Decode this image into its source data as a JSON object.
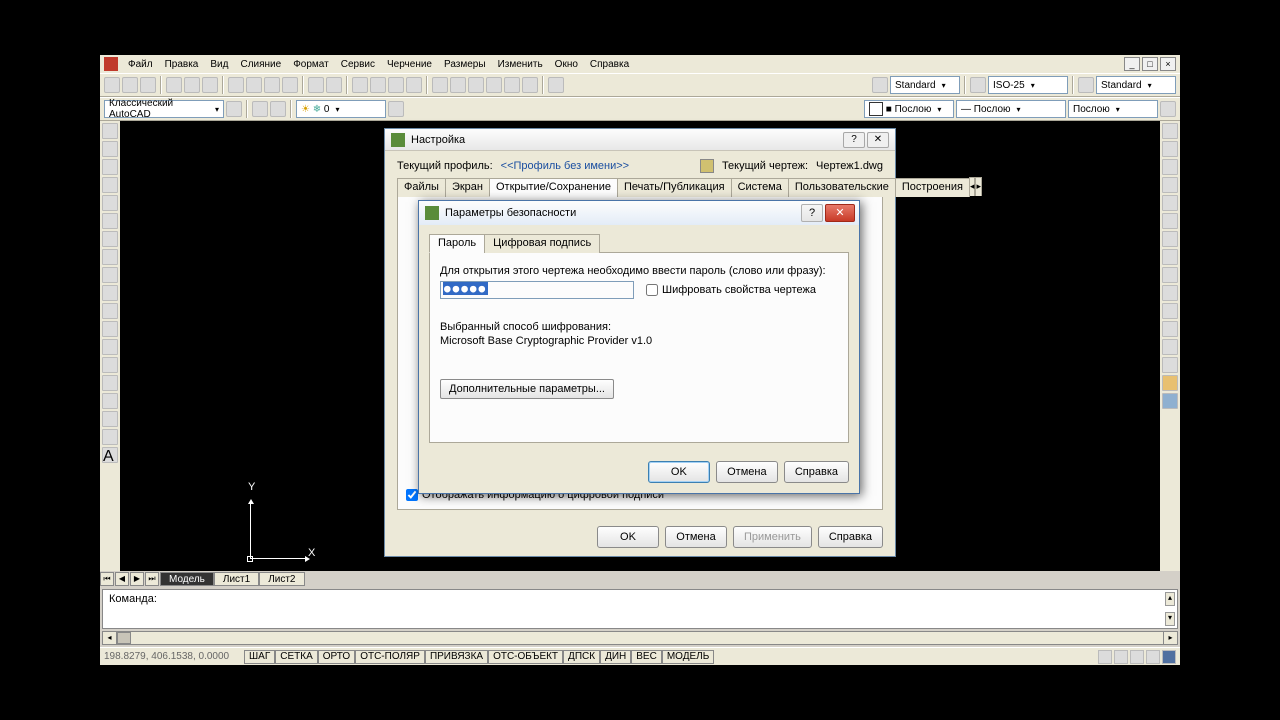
{
  "menu": {
    "items": [
      "Файл",
      "Правка",
      "Вид",
      "Слияние",
      "Формат",
      "Сервис",
      "Черчение",
      "Размеры",
      "Изменить",
      "Окно",
      "Справка"
    ]
  },
  "toolbar1": {
    "style_a": "Standard",
    "style_b": "ISO-25",
    "style_c": "Standard"
  },
  "toolbar2": {
    "profile_dd": "Классический AutoCAD",
    "layer_state": "0",
    "color_label": "■ Послою",
    "linetype_label": "— Послою",
    "lineweight_label": "Послою"
  },
  "model_tabs": {
    "model": "Модель",
    "sheet1": "Лист1",
    "sheet2": "Лист2"
  },
  "ucs": {
    "y": "Y",
    "x": "X"
  },
  "cmd": {
    "prompt": "Команда:"
  },
  "status": {
    "coords": "198.8279, 406.1538, 0.0000",
    "buttons": [
      "ШАГ",
      "СЕТКА",
      "ОРТО",
      "ОТС-ПОЛЯР",
      "ПРИВЯЗКА",
      "ОТС-ОБЪЕКТ",
      "ДПСК",
      "ДИН",
      "ВЕС",
      "МОДЕЛЬ"
    ]
  },
  "settings": {
    "title": "Настройка",
    "profile_label": "Текущий профиль:",
    "profile_name": "<<Профиль без имени>>",
    "drawing_label": "Текущий чертеж:",
    "drawing_name": "Чертеж1.dwg",
    "tabs": [
      "Файлы",
      "Экран",
      "Открытие/Сохранение",
      "Печать/Публикация",
      "Система",
      "Пользовательские",
      "Построения"
    ],
    "active_tab": 2,
    "digital_sig_chk": "Отображать информацию о цифровой подписи",
    "buttons": {
      "ok": "OK",
      "cancel": "Отмена",
      "apply": "Применить",
      "help": "Справка"
    }
  },
  "security": {
    "title": "Параметры безопасности",
    "tabs": {
      "password": "Пароль",
      "signature": "Цифровая подпись"
    },
    "prompt": "Для открытия этого чертежа необходимо ввести пароль (слово или фразу):",
    "password_mask": "●●●●●",
    "encrypt_props_chk": "Шифровать свойства чертежа",
    "enc_method_label": "Выбранный способ шифрования:",
    "enc_method_value": "Microsoft Base Cryptographic Provider v1.0",
    "advanced_btn": "Дополнительные параметры...",
    "buttons": {
      "ok": "OK",
      "cancel": "Отмена",
      "help": "Справка"
    }
  }
}
